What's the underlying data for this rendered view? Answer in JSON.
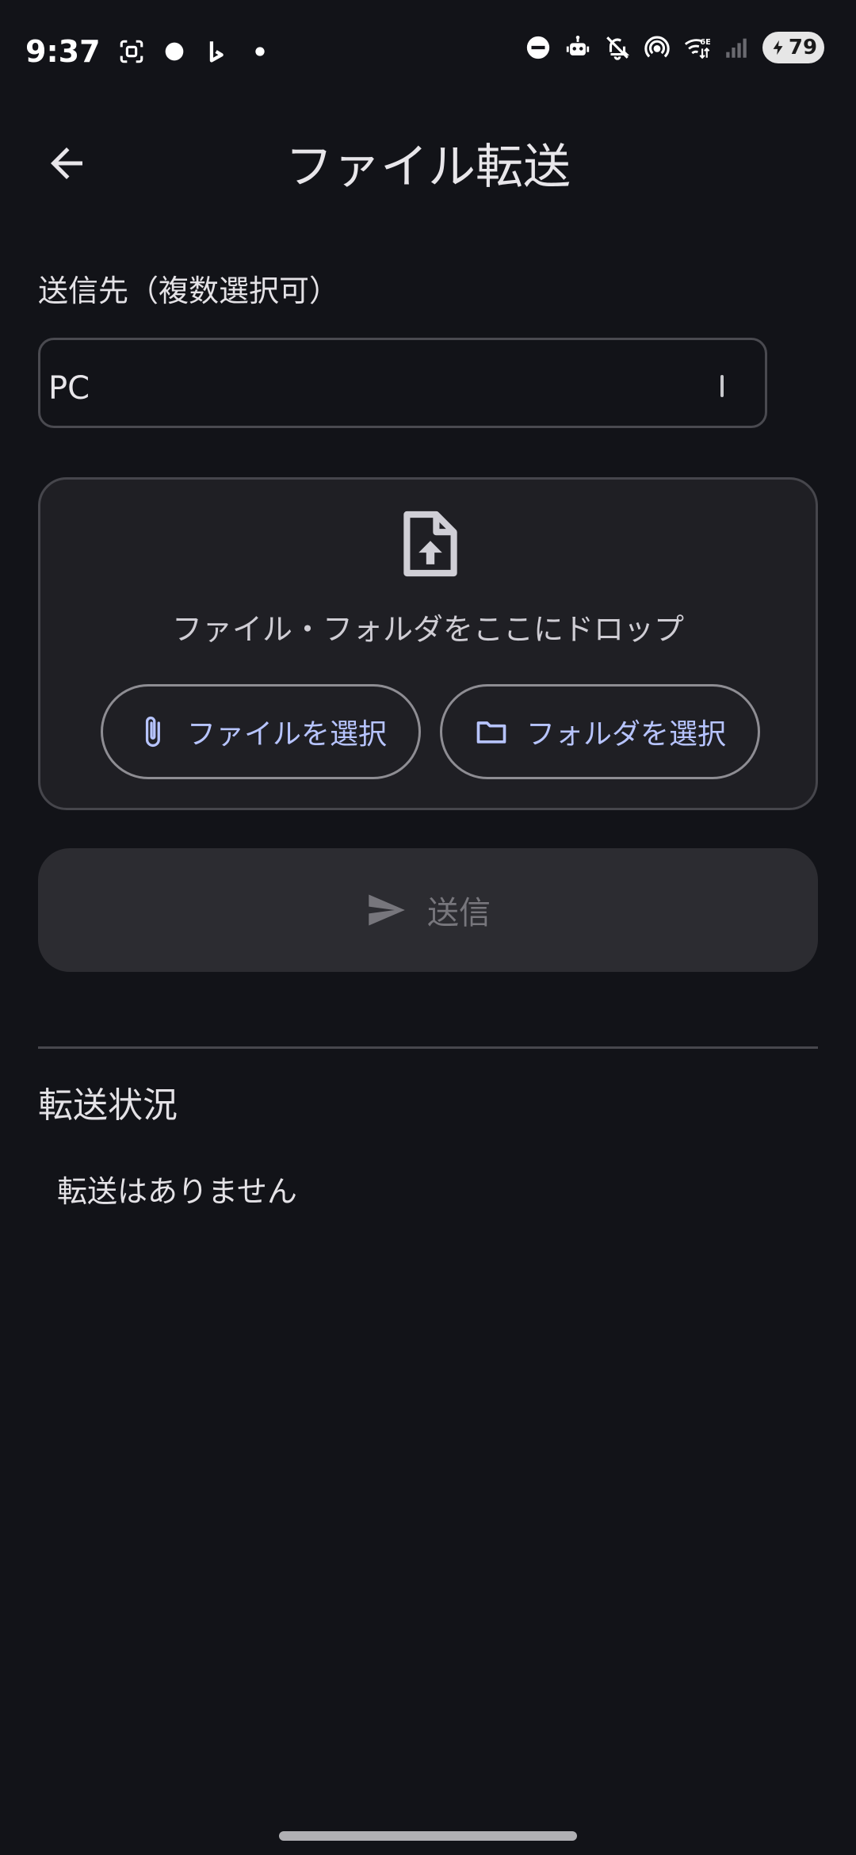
{
  "status_bar": {
    "time": "9:37",
    "battery_level": "79",
    "icons_left": [
      "screenshot-icon",
      "record-dot-icon",
      "bing-icon",
      "small-dot-icon"
    ],
    "icons_right": [
      "dnd-icon",
      "robot-icon",
      "mute-icon",
      "hotspot-icon",
      "wifi-6e-icon",
      "signal-icon"
    ]
  },
  "app_bar": {
    "back_icon": "arrow-back-icon",
    "title": "ファイル転送"
  },
  "destination": {
    "label": "送信先（複数選択可）",
    "value": "PC"
  },
  "drop_zone": {
    "icon": "upload-file-icon",
    "text": "ファイル・フォルダをここにドロップ",
    "select_file_label": "ファイルを選択",
    "select_file_icon": "paperclip-icon",
    "select_folder_label": "フォルダを選択",
    "select_folder_icon": "folder-icon"
  },
  "send": {
    "label": "送信",
    "icon": "send-icon"
  },
  "transfers": {
    "heading": "転送状況",
    "empty_text": "転送はありません"
  },
  "colors": {
    "background": "#121318",
    "surface": "#1f1f24",
    "accent": "#b7c4ff",
    "disabled_text": "#77767c"
  }
}
